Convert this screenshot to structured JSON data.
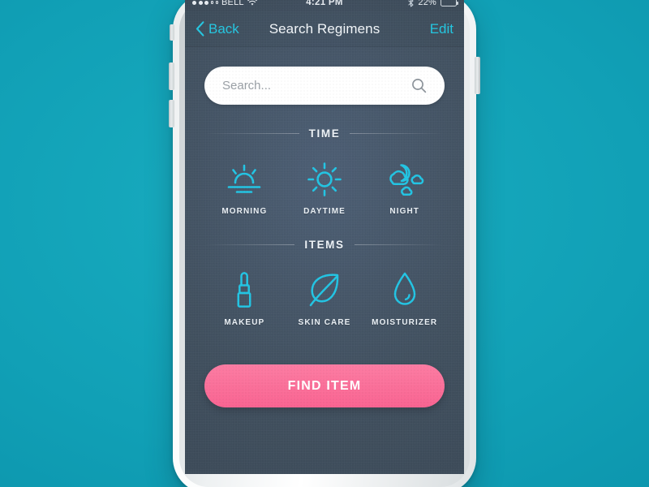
{
  "theme": {
    "accent_cyan": "#25c6e0",
    "accent_pink": "#fa6e98",
    "screen_bg": "#465668",
    "page_bg": "#11a0b6"
  },
  "status_bar": {
    "carrier": "BELL",
    "signal_filled": 3,
    "signal_empty": 2,
    "wifi_icon": "wifi-icon",
    "time": "4:21 PM",
    "bluetooth_icon": "bluetooth-icon",
    "battery_percent": "22%",
    "battery_level": 22
  },
  "nav_bar": {
    "back_icon": "chevron-left-icon",
    "back_label": "Back",
    "title": "Search Regimens",
    "edit_label": "Edit"
  },
  "search": {
    "placeholder": "Search...",
    "value": "",
    "icon": "search-icon"
  },
  "sections": [
    {
      "title": "TIME",
      "items": [
        {
          "icon": "sunrise-icon",
          "label": "MORNING"
        },
        {
          "icon": "sun-icon",
          "label": "DAYTIME"
        },
        {
          "icon": "moon-cloud-icon",
          "label": "NIGHT"
        }
      ]
    },
    {
      "title": "ITEMS",
      "items": [
        {
          "icon": "lipstick-icon",
          "label": "MAKEUP"
        },
        {
          "icon": "leaf-icon",
          "label": "SKIN CARE"
        },
        {
          "icon": "water-drop-icon",
          "label": "MOISTURIZER"
        }
      ]
    }
  ],
  "cta": {
    "label": "FIND ITEM"
  }
}
